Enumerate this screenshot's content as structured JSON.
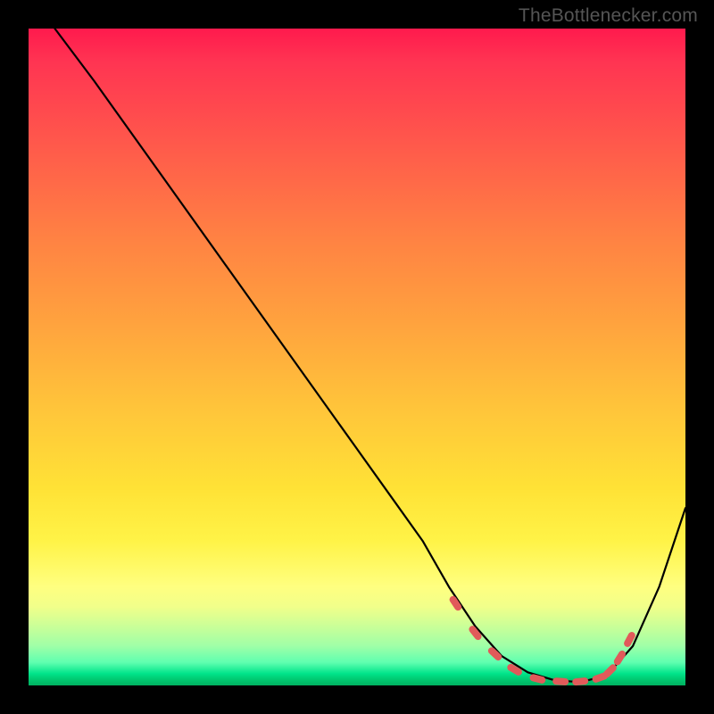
{
  "watermark": "TheBottlenecker.com",
  "chart_data": {
    "type": "line",
    "title": "",
    "xlabel": "",
    "ylabel": "",
    "xlim": [
      0,
      100
    ],
    "ylim": [
      0,
      100
    ],
    "series": [
      {
        "name": "curve",
        "x": [
          4,
          10,
          20,
          30,
          40,
          50,
          55,
          60,
          64,
          68,
          72,
          76,
          80,
          84,
          88,
          92,
          96,
          100
        ],
        "y": [
          100,
          92,
          78,
          64,
          50,
          36,
          29,
          22,
          15,
          9,
          4.5,
          2,
          0.8,
          0.5,
          1.5,
          6,
          15,
          27
        ]
      }
    ],
    "markers": {
      "name": "optimal-range",
      "color": "#e15a5a",
      "x": [
        65,
        68,
        71,
        74,
        77.5,
        81,
        84,
        87,
        88.5,
        90,
        91.5
      ],
      "y": [
        12.5,
        8,
        4.8,
        2.4,
        1.0,
        0.6,
        0.6,
        1.2,
        2.2,
        4.2,
        7.0
      ]
    }
  }
}
